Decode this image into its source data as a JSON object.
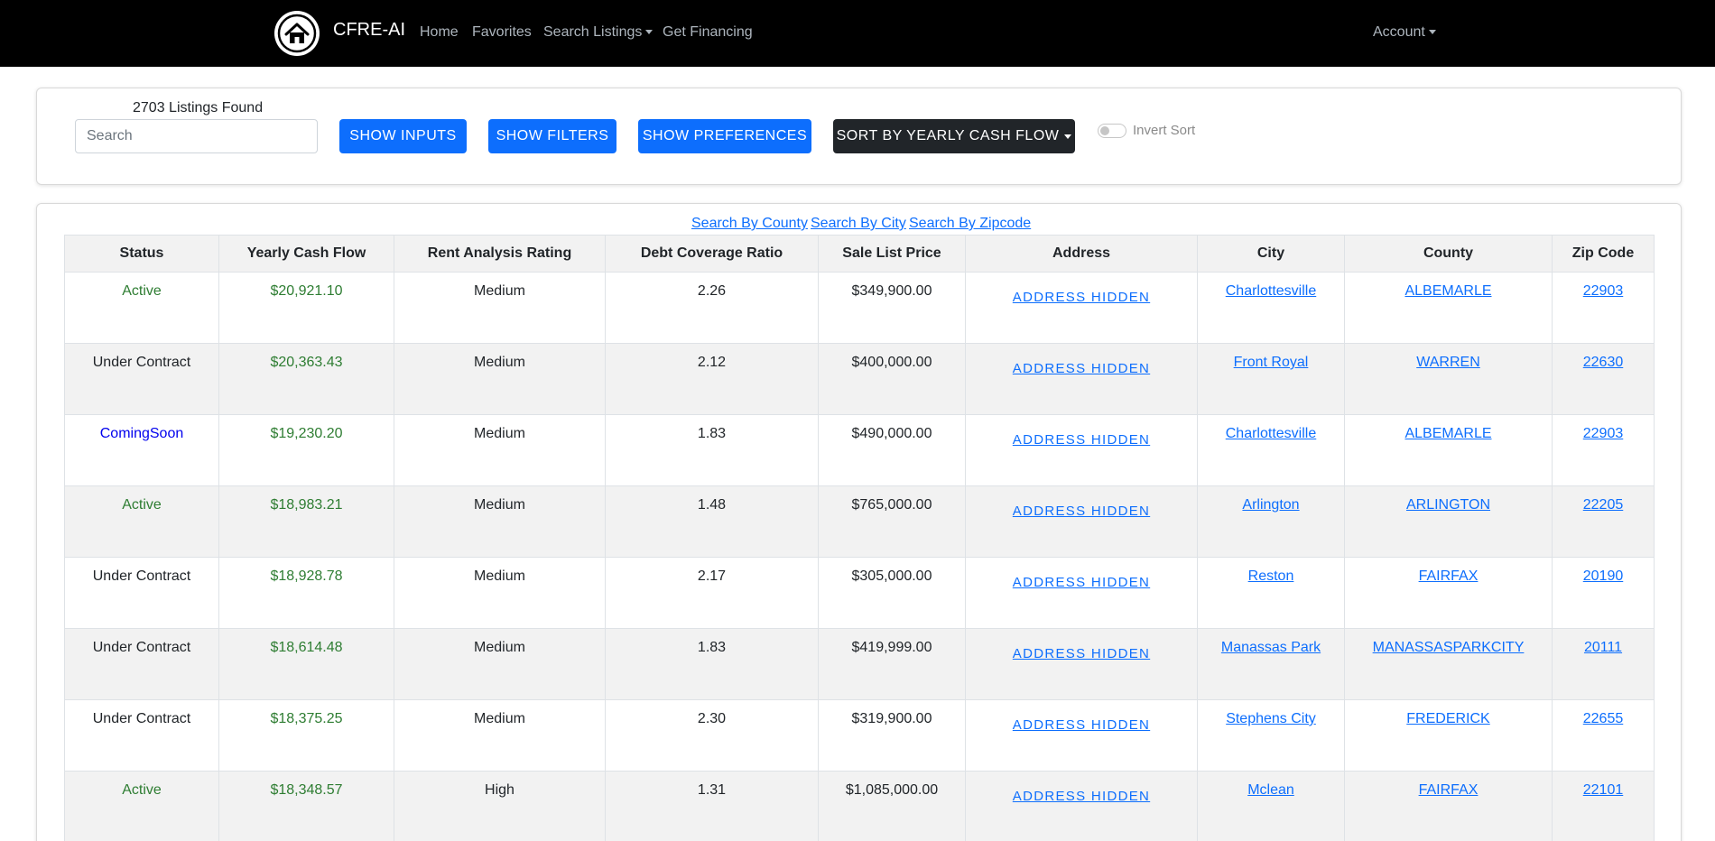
{
  "navbar": {
    "brand": "CFRE-AI",
    "logo_icon": "house-icon",
    "links": {
      "home": "Home",
      "favorites": "Favorites",
      "search_listings": "Search Listings",
      "get_financing": "Get Financing",
      "account": "Account"
    }
  },
  "controls": {
    "listings_found": "2703 Listings Found",
    "search_placeholder": "Search",
    "search_value": "",
    "show_inputs": "SHOW INPUTS",
    "show_filters": "SHOW FILTERS",
    "show_preferences": "SHOW PREFERENCES",
    "sort_by": "SORT BY YEARLY CASH FLOW",
    "invert_sort_label": "Invert Sort",
    "invert_sort_on": false
  },
  "search_links": {
    "county": "Search By County",
    "city": "Search By City",
    "zipcode": "Search By Zipcode"
  },
  "table": {
    "headers": [
      "Status",
      "Yearly Cash Flow",
      "Rent Analysis Rating",
      "Debt Coverage Ratio",
      "Sale List Price",
      "Address",
      "City",
      "County",
      "Zip Code"
    ],
    "rows": [
      {
        "status": "Active",
        "cash_flow": "$20,921.10",
        "rating": "Medium",
        "dcr": "2.26",
        "price": "$349,900.00",
        "address": "ADDRESS HIDDEN",
        "city": "Charlottesville",
        "county": "ALBEMARLE",
        "zip": "22903"
      },
      {
        "status": "Under Contract",
        "cash_flow": "$20,363.43",
        "rating": "Medium",
        "dcr": "2.12",
        "price": "$400,000.00",
        "address": "ADDRESS HIDDEN",
        "city": "Front Royal",
        "county": "WARREN",
        "zip": "22630"
      },
      {
        "status": "ComingSoon",
        "cash_flow": "$19,230.20",
        "rating": "Medium",
        "dcr": "1.83",
        "price": "$490,000.00",
        "address": "ADDRESS HIDDEN",
        "city": "Charlottesville",
        "county": "ALBEMARLE",
        "zip": "22903"
      },
      {
        "status": "Active",
        "cash_flow": "$18,983.21",
        "rating": "Medium",
        "dcr": "1.48",
        "price": "$765,000.00",
        "address": "ADDRESS HIDDEN",
        "city": "Arlington",
        "county": "ARLINGTON",
        "zip": "22205"
      },
      {
        "status": "Under Contract",
        "cash_flow": "$18,928.78",
        "rating": "Medium",
        "dcr": "2.17",
        "price": "$305,000.00",
        "address": "ADDRESS HIDDEN",
        "city": "Reston",
        "county": "FAIRFAX",
        "zip": "20190"
      },
      {
        "status": "Under Contract",
        "cash_flow": "$18,614.48",
        "rating": "Medium",
        "dcr": "1.83",
        "price": "$419,999.00",
        "address": "ADDRESS HIDDEN",
        "city": "Manassas Park",
        "county": "MANASSASPARKCITY",
        "zip": "20111"
      },
      {
        "status": "Under Contract",
        "cash_flow": "$18,375.25",
        "rating": "Medium",
        "dcr": "2.30",
        "price": "$319,900.00",
        "address": "ADDRESS HIDDEN",
        "city": "Stephens City",
        "county": "FREDERICK",
        "zip": "22655"
      },
      {
        "status": "Active",
        "cash_flow": "$18,348.57",
        "rating": "High",
        "dcr": "1.31",
        "price": "$1,085,000.00",
        "address": "ADDRESS HIDDEN",
        "city": "Mclean",
        "county": "FAIRFAX",
        "zip": "22101"
      }
    ]
  },
  "colors": {
    "navbar_bg": "#000000",
    "primary": "#0d6efd",
    "dark_button": "#212529",
    "positive_green": "#2e7d32",
    "coming_soon_blue": "#0000ee",
    "stripe": "#f2f2f2"
  }
}
